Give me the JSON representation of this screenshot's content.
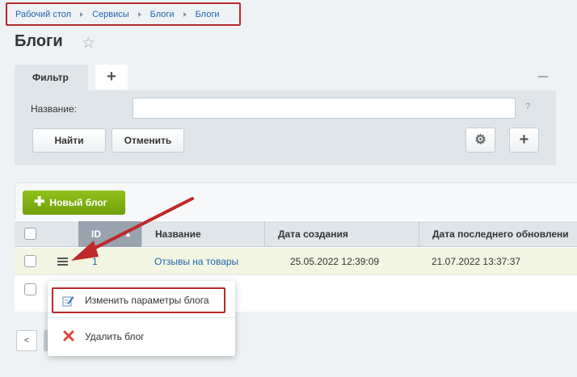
{
  "breadcrumb": [
    "Рабочий стол",
    "Сервисы",
    "Блоги",
    "Блоги"
  ],
  "page_title": "Блоги",
  "filter": {
    "tab_label": "Фильтр",
    "add_tab": "+",
    "name_label": "Название:",
    "name_value": "",
    "help": "?",
    "find_label": "Найти",
    "cancel_label": "Отменить",
    "plus_label": "+"
  },
  "toolbar": {
    "new_label": "Новый блог"
  },
  "table": {
    "columns": [
      "ID",
      "Название",
      "Дата создания",
      "Дата последнего обновлени"
    ],
    "rows": [
      {
        "id": "1",
        "name": "Отзывы на товары",
        "created": "25.05.2022 12:39:09",
        "updated": "21.07.2022 13:37:37"
      }
    ]
  },
  "context_menu": {
    "items": [
      "Изменить параметры блога",
      "Удалить блог"
    ]
  },
  "colors": {
    "accent": "#6fa007",
    "link": "#2067b0",
    "highlight": "#b52b2b"
  }
}
